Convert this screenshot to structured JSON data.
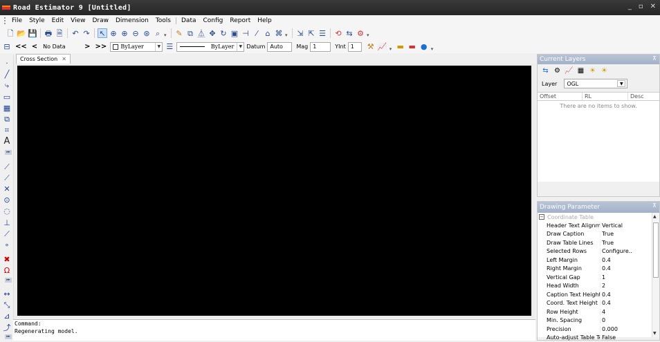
{
  "window": {
    "title": "Road Estimator 9 [Untitled]",
    "min": "_",
    "max": "▫",
    "close": "✕"
  },
  "menu": [
    "File",
    "Style",
    "Edit",
    "View",
    "Draw",
    "Dimension",
    "Tools",
    "Data",
    "Config",
    "Report",
    "Help"
  ],
  "toolbar2": {
    "first": "<<",
    "prev": "<",
    "station": "No Data",
    "next": ">",
    "last": ">>",
    "layer_combo": "ByLayer",
    "linetype_combo": "ByLayer",
    "datum_label": "Datum",
    "datum_value": "Auto",
    "mag_label": "Mag",
    "mag_value": "1",
    "yint_label": "YInt",
    "yint_value": "1"
  },
  "doc_tab": {
    "label": "Cross Section",
    "close": "✕"
  },
  "command": {
    "line1": "Command:",
    "line2": " Regenerating model."
  },
  "current_layers": {
    "title": "Current Layers",
    "layer_label": "Layer",
    "layer_value": "OGL",
    "columns": [
      "Offset",
      "RL",
      "Desc"
    ],
    "empty_message": "There are no items to show."
  },
  "drawing_parameter": {
    "title": "Drawing Parameter",
    "category": "Coordinate Table",
    "rows": [
      {
        "k": "Header Text Alignmen",
        "v": "Vertical"
      },
      {
        "k": "Draw Caption",
        "v": "True"
      },
      {
        "k": "Draw Table Lines",
        "v": "True"
      },
      {
        "k": "Selected Rows",
        "v": "Configure.."
      },
      {
        "k": "Left Margin",
        "v": "0.4"
      },
      {
        "k": "Right Margin",
        "v": "0.4"
      },
      {
        "k": "Vertical Gap",
        "v": "1"
      },
      {
        "k": "Head Width",
        "v": "2"
      },
      {
        "k": "Caption Text Height",
        "v": "0.4"
      },
      {
        "k": "Coord. Text Height",
        "v": "0.4"
      },
      {
        "k": "Row Height",
        "v": "4"
      },
      {
        "k": "Min. Spacing",
        "v": "0"
      },
      {
        "k": "Precision",
        "v": "0.000"
      },
      {
        "k": "Auto-adjust Table Text",
        "v": "False"
      }
    ]
  },
  "colors": {
    "canvas": "#000000",
    "panel_header": "#a3b1c7",
    "titlebar": "#2b2b2b"
  }
}
